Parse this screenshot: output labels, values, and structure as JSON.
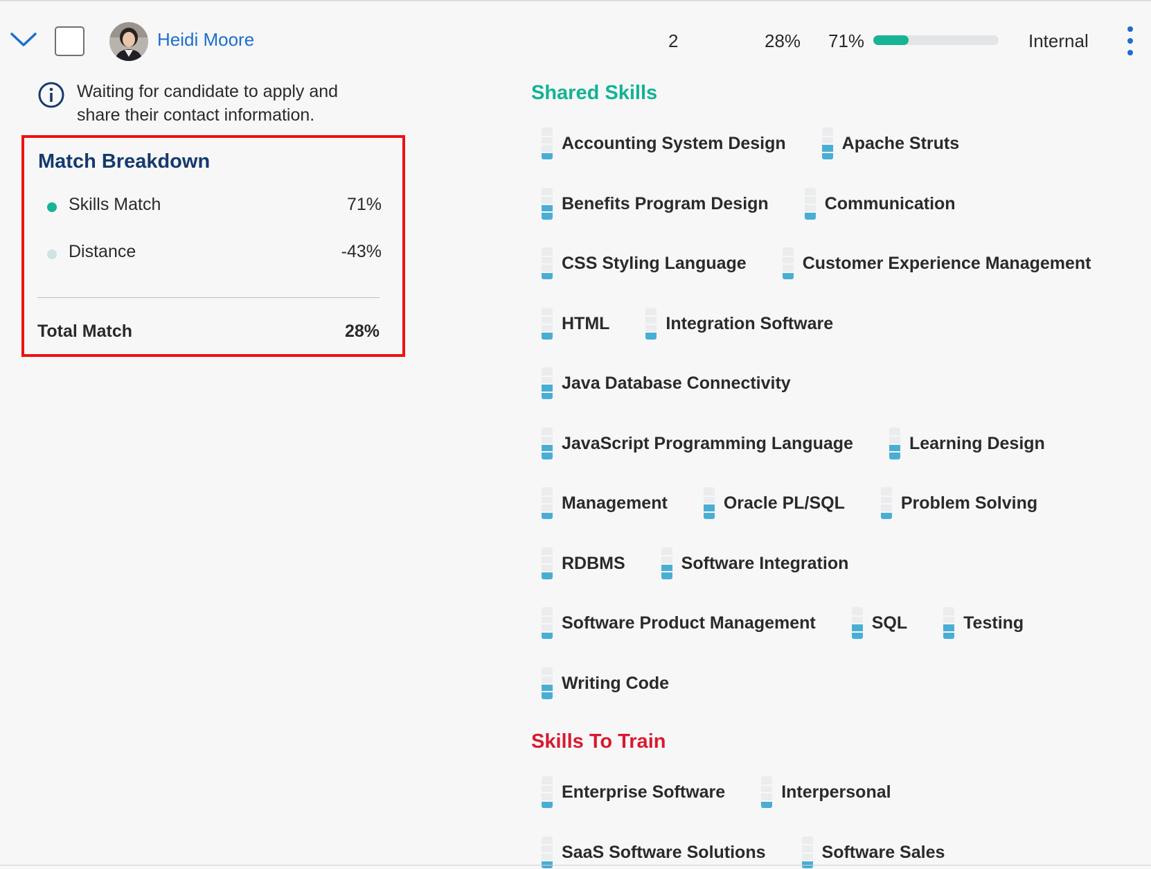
{
  "candidate": {
    "name": "Heidi Moore",
    "count": "2",
    "total_match": "28%",
    "skills_match": "71%",
    "skills_match_fraction": 0.28,
    "type": "Internal",
    "avatar_icon": "person-avatar",
    "info_text": "Waiting for candidate to apply and share their contact information."
  },
  "match_breakdown": {
    "title": "Match Breakdown",
    "rows": [
      {
        "label": "Skills Match",
        "value": "71%",
        "dot_color": "#17b394"
      },
      {
        "label": "Distance",
        "value": "-43%",
        "dot_color": "#cfe3e3"
      }
    ],
    "total_label": "Total Match",
    "total_value": "28%"
  },
  "colors": {
    "accent": "#1a6fce",
    "shared": "#12b394",
    "train": "#d9192f",
    "level_fill": "#4aaed4",
    "highlight_border": "#ee1111"
  },
  "shared_skills": {
    "title": "Shared Skills",
    "rows": [
      [
        {
          "name": "Accounting System Design",
          "level": 0.25
        },
        {
          "name": "Apache Struts",
          "level": 0.5
        }
      ],
      [
        {
          "name": "Benefits Program Design",
          "level": 0.5
        },
        {
          "name": "Communication",
          "level": 0.25
        }
      ],
      [
        {
          "name": "CSS Styling Language",
          "level": 0.25
        },
        {
          "name": "Customer Experience Management",
          "level": 0.25
        }
      ],
      [
        {
          "name": "HTML",
          "level": 0.25
        },
        {
          "name": "Integration Software",
          "level": 0.25
        }
      ],
      [
        {
          "name": "Java Database Connectivity",
          "level": 0.5
        }
      ],
      [
        {
          "name": "JavaScript Programming Language",
          "level": 0.5
        },
        {
          "name": "Learning Design",
          "level": 0.5
        }
      ],
      [
        {
          "name": "Management",
          "level": 0.25
        },
        {
          "name": "Oracle PL/SQL",
          "level": 0.5
        },
        {
          "name": "Problem Solving",
          "level": 0.25
        }
      ],
      [
        {
          "name": "RDBMS",
          "level": 0.25
        },
        {
          "name": "Software Integration",
          "level": 0.5
        }
      ],
      [
        {
          "name": "Software Product Management",
          "level": 0.25
        },
        {
          "name": "SQL",
          "level": 0.5
        },
        {
          "name": "Testing",
          "level": 0.5
        }
      ],
      [
        {
          "name": "Writing Code",
          "level": 0.5
        }
      ]
    ]
  },
  "skills_to_train": {
    "title": "Skills To Train",
    "rows": [
      [
        {
          "name": "Enterprise Software",
          "level": 0.25
        },
        {
          "name": "Interpersonal",
          "level": 0.25
        }
      ],
      [
        {
          "name": "SaaS Software Solutions",
          "level": 0.25
        },
        {
          "name": "Software Sales",
          "level": 0.25
        }
      ]
    ]
  }
}
